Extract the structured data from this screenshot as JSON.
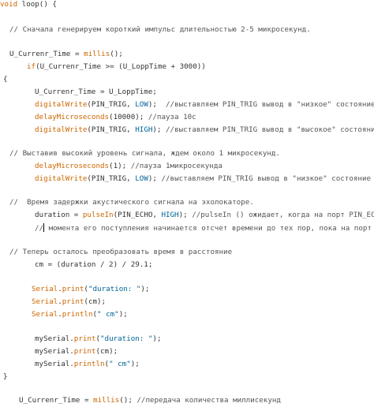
{
  "lines": {
    "l1": [
      "void",
      " loop() {"
    ],
    "l2": "// Сначала генерируем короткий импульс длительностью 2-5 микросекунд.",
    "l3": [
      "U_Currenr_Time = ",
      "millis",
      "();"
    ],
    "l4": [
      "if",
      "(U_Currenr_Time >= (U_LoppTime + 3000))"
    ],
    "l5": "{",
    "l6": "U_Currenr_Time = U_LoppTime;",
    "l7": [
      "digitalWrite",
      "(PIN_TRIG, ",
      "LOW",
      ");  ",
      "//выставляем PIN_TRIG вывод в \"низкое\" состояние"
    ],
    "l8": [
      "delayMicroseconds",
      "(10000); ",
      "//пауза 10с"
    ],
    "l9": [
      "digitalWrite",
      "(PIN_TRIG, ",
      "HIGH",
      "); ",
      "//выставляем PIN_TRIG вывод в \"высокое\" состояние"
    ],
    "l10": "// Выставив высокий уровень сигнала, ждем около 1 микросекунд.",
    "l11": [
      "delayMicroseconds",
      "(1); ",
      "//пауза 1микросекунда"
    ],
    "l12": [
      "digitalWrite",
      "(PIN_TRIG, ",
      "LOW",
      "); ",
      "//выставляем PIN_TRIG вывод в \"низкое\" состояние"
    ],
    "l13": "//  Время задержки акустического сигнала на эхолокаторе.",
    "l14": [
      "duration = ",
      "pulseIn",
      "(PIN_ECHO, ",
      "HIGH",
      "); ",
      "//pulseIn () ожидает, когда на порт PIN_ECHO"
    ],
    "l15": [
      "//",
      " момента его поступления начинается отсчет времени до тех пор, пока на порт"
    ],
    "l16": "// Теперь осталось преобразовать время в расстояние",
    "l17": "cm = (duration / 2) / 29.1;",
    "l18": [
      "Serial",
      ".",
      "print",
      "(",
      "\"duration: \"",
      ");"
    ],
    "l19": [
      "Serial",
      ".",
      "print",
      "(cm);"
    ],
    "l20": [
      "Serial",
      ".",
      "println",
      "(",
      "\" cm\"",
      ");"
    ],
    "l21": [
      "mySerial.",
      "print",
      "(",
      "\"duration: \"",
      ");"
    ],
    "l22": [
      "mySerial.",
      "print",
      "(cm);"
    ],
    "l23": [
      "mySerial.",
      "println",
      "(",
      "\" cm\"",
      ");"
    ],
    "l24": "}",
    "l25": [
      "U_Currenr_Time = ",
      "millis",
      "(); ",
      "//передача количества миллисекунд"
    ]
  },
  "colors": {
    "keyword": "#cc6600",
    "function": "#006699",
    "comment": "#555555",
    "text": "#333333"
  }
}
